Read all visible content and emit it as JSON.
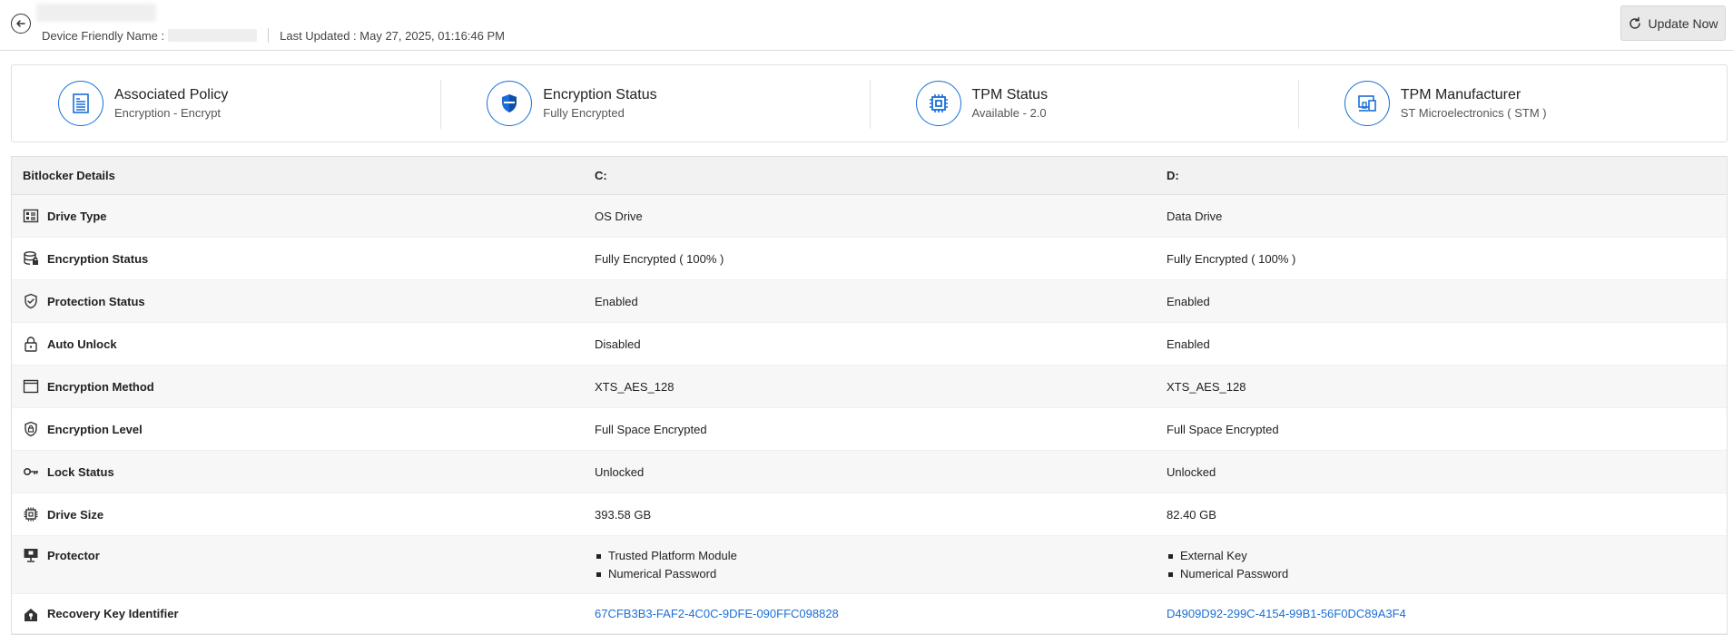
{
  "header": {
    "device_friendly_name_label": "Device Friendly Name :",
    "last_updated": "Last Updated : May 27, 2025, 01:16:46 PM",
    "update_button_label": "Update Now"
  },
  "summary": [
    {
      "title": "Associated Policy",
      "sub": "Encryption - Encrypt",
      "icon": "policy-document-icon"
    },
    {
      "title": "Encryption Status",
      "sub": "Fully Encrypted",
      "icon": "shield-icon"
    },
    {
      "title": "TPM Status",
      "sub": "Available - 2.0",
      "icon": "chip-icon"
    },
    {
      "title": "TPM Manufacturer",
      "sub": "ST Microelectronics ( STM )",
      "icon": "devices-icon"
    }
  ],
  "table": {
    "headers": [
      "Bitlocker Details",
      "C:",
      "D:"
    ],
    "rows": [
      {
        "label": "Drive Type",
        "icon": "drive-type-icon",
        "c": "OS Drive",
        "d": "Data Drive"
      },
      {
        "label": "Encryption Status",
        "icon": "database-icon",
        "c": "Fully Encrypted ( 100% )",
        "d": "Fully Encrypted ( 100% )"
      },
      {
        "label": "Protection Status",
        "icon": "shield-check-icon",
        "c": "Enabled",
        "d": "Enabled"
      },
      {
        "label": "Auto Unlock",
        "icon": "lock-icon",
        "c": "Disabled",
        "d": "Enabled"
      },
      {
        "label": "Encryption Method",
        "icon": "window-icon",
        "c": "XTS_AES_128",
        "d": "XTS_AES_128"
      },
      {
        "label": "Encryption Level",
        "icon": "shield-lock-icon",
        "c": "Full Space Encrypted",
        "d": "Full Space Encrypted"
      },
      {
        "label": "Lock Status",
        "icon": "key-icon",
        "c": "Unlocked",
        "d": "Unlocked"
      },
      {
        "label": "Drive Size",
        "icon": "chip-icon",
        "c": "393.58 GB",
        "d": "82.40 GB"
      }
    ],
    "protector": {
      "label": "Protector",
      "icon": "monitor-icon",
      "c": [
        "Trusted Platform Module",
        "Numerical Password"
      ],
      "d": [
        "External Key",
        "Numerical Password"
      ]
    },
    "recovery": {
      "label": "Recovery Key Identifier",
      "icon": "home-key-icon",
      "c": "67CFB3B3-FAF2-4C0C-9DFE-090FFC098828",
      "d": "D4909D92-299C-4154-99B1-56F0DC89A3F4"
    }
  }
}
